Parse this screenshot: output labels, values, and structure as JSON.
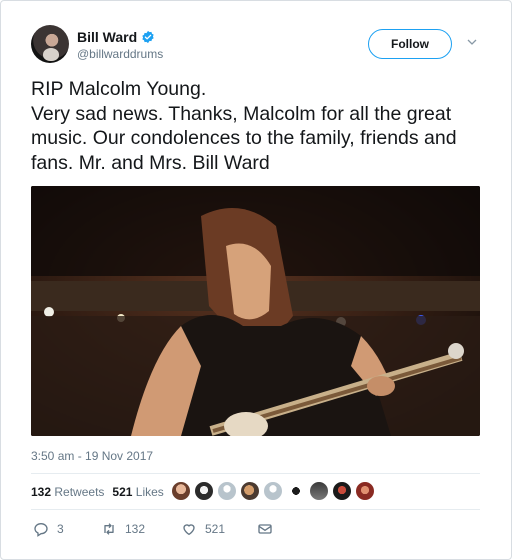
{
  "tweet": {
    "display_name": "Bill Ward",
    "handle": "@billwarddrums",
    "verified": true,
    "follow_label": "Follow",
    "text": "RIP Malcolm Young.\nVery sad news.  Thanks, Malcolm for all the great music. Our condolences to the family, friends and fans.  Mr. and Mrs. Bill Ward",
    "timestamp": "3:50 am - 19 Nov 2017",
    "retweets_count": "132",
    "retweets_label": "Retweets",
    "likes_count": "521",
    "likes_label": "Likes"
  },
  "actions": {
    "reply_count": "3",
    "retweet_count": "132",
    "like_count": "521"
  },
  "icons": {
    "verified": "verified-badge-icon",
    "caret": "chevron-down-icon",
    "reply": "reply-icon",
    "retweet": "retweet-icon",
    "like": "heart-icon",
    "message": "direct-message-icon"
  },
  "colors": {
    "accent": "#1da1f2",
    "text": "#14171a",
    "muted": "#657786",
    "border": "#e6ecf0"
  }
}
